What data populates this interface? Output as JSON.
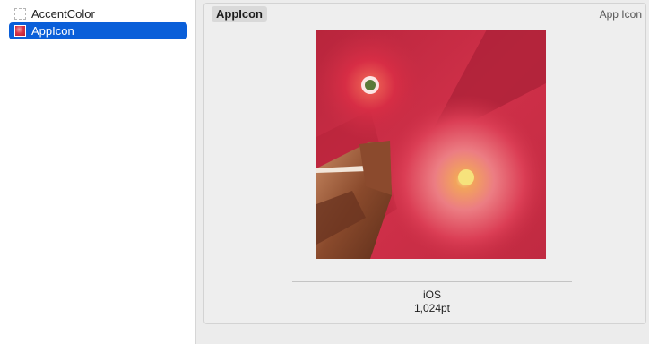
{
  "sidebar": {
    "items": [
      {
        "label": "AccentColor",
        "icon": "color-set-icon",
        "selected": false
      },
      {
        "label": "AppIcon",
        "icon": "app-icon-thumbnail",
        "selected": true
      }
    ]
  },
  "detail": {
    "set_name": "AppIcon",
    "set_type": "App Icon",
    "slot": {
      "platform": "iOS",
      "size": "1,024pt"
    }
  },
  "colors": {
    "selection": "#0a5fd9",
    "icon_base": "#c92d44"
  }
}
